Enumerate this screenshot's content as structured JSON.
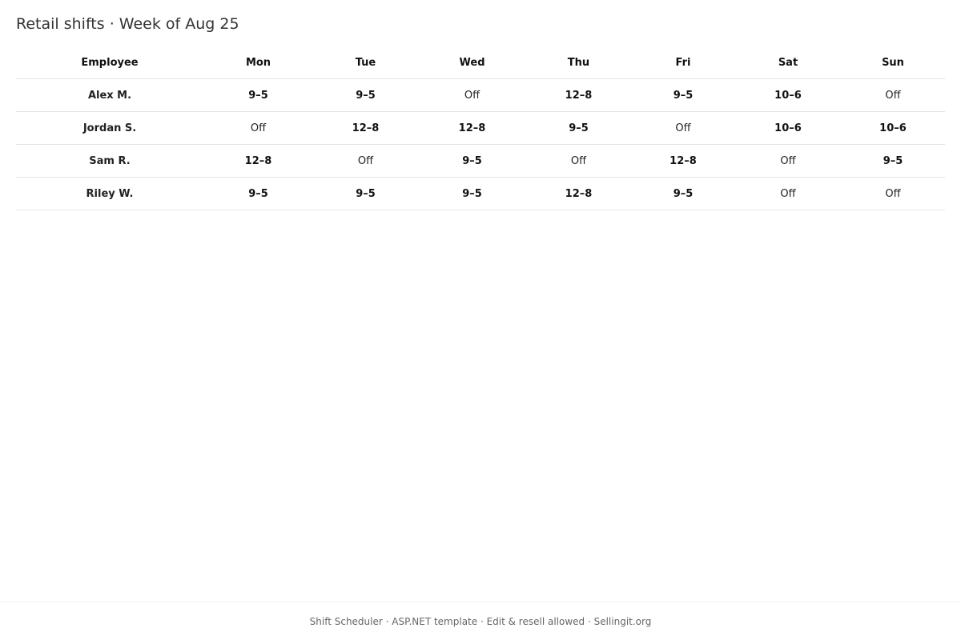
{
  "page": {
    "title": "Retail shifts · Week of Aug 25"
  },
  "schedule": {
    "columns": [
      "Employee",
      "Mon",
      "Tue",
      "Wed",
      "Thu",
      "Fri",
      "Sat",
      "Sun"
    ],
    "rows": [
      {
        "employee": "Alex M.",
        "shifts": [
          "9–5",
          "9–5",
          "Off",
          "12–8",
          "9–5",
          "10–6",
          "Off"
        ]
      },
      {
        "employee": "Jordan S.",
        "shifts": [
          "Off",
          "12–8",
          "12–8",
          "9–5",
          "Off",
          "10–6",
          "10–6"
        ]
      },
      {
        "employee": "Sam R.",
        "shifts": [
          "12–8",
          "Off",
          "9–5",
          "Off",
          "12–8",
          "Off",
          "9–5"
        ]
      },
      {
        "employee": "Riley W.",
        "shifts": [
          "9–5",
          "9–5",
          "9–5",
          "12–8",
          "9–5",
          "Off",
          "Off"
        ]
      }
    ]
  },
  "footer": {
    "text": "Shift Scheduler · ASP.NET template · Edit & resell allowed · Sellingit.org"
  }
}
